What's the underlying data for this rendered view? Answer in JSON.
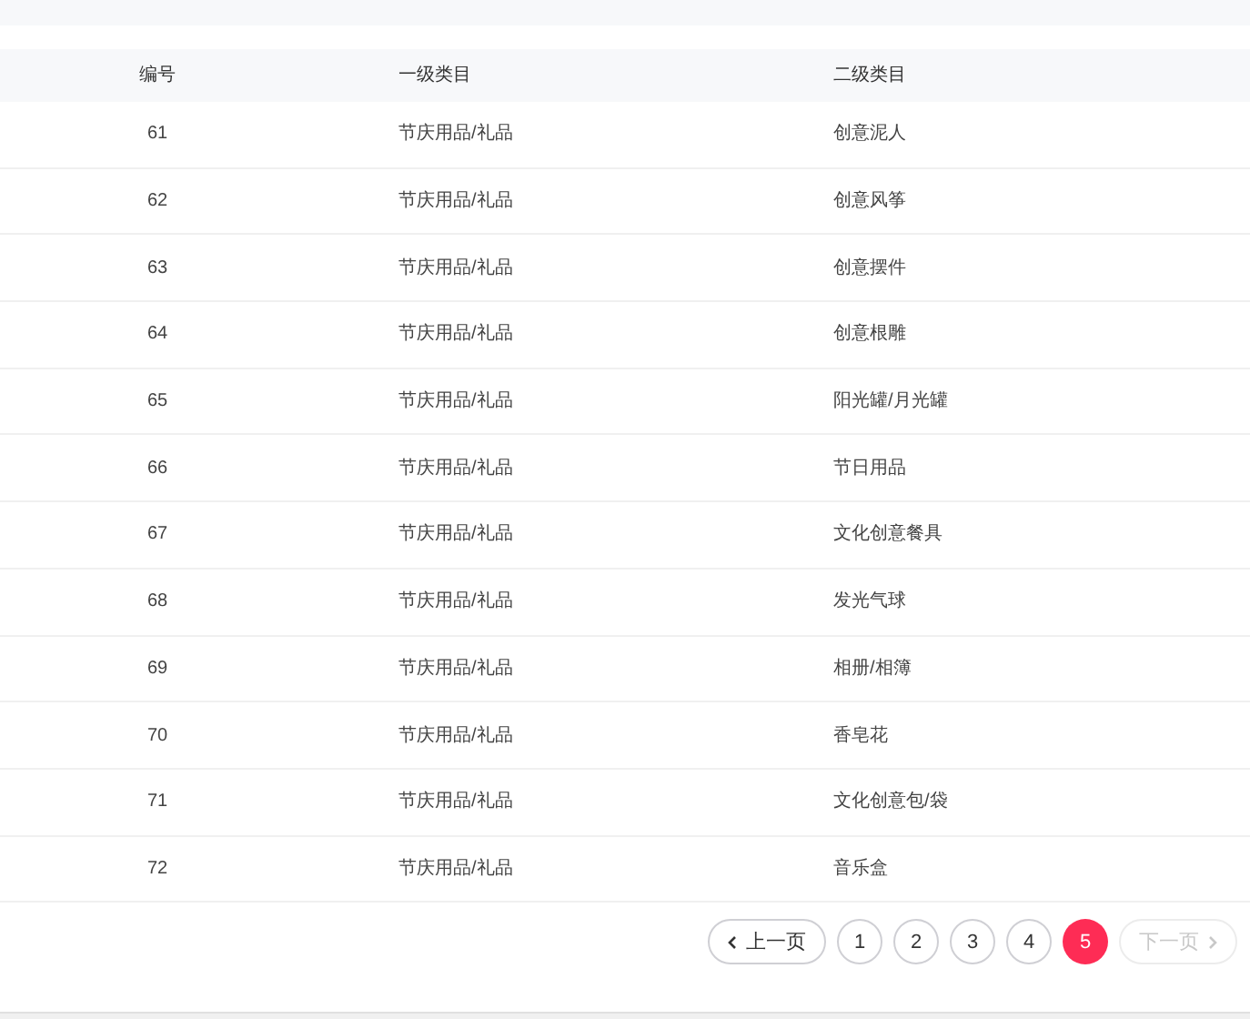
{
  "table": {
    "columns": [
      "编号",
      "一级类目",
      "二级类目"
    ],
    "rows": [
      {
        "id": "61",
        "level1": "节庆用品/礼品",
        "level2": "创意泥人"
      },
      {
        "id": "62",
        "level1": "节庆用品/礼品",
        "level2": "创意风筝"
      },
      {
        "id": "63",
        "level1": "节庆用品/礼品",
        "level2": "创意摆件"
      },
      {
        "id": "64",
        "level1": "节庆用品/礼品",
        "level2": "创意根雕"
      },
      {
        "id": "65",
        "level1": "节庆用品/礼品",
        "level2": "阳光罐/月光罐"
      },
      {
        "id": "66",
        "level1": "节庆用品/礼品",
        "level2": "节日用品"
      },
      {
        "id": "67",
        "level1": "节庆用品/礼品",
        "level2": "文化创意餐具"
      },
      {
        "id": "68",
        "level1": "节庆用品/礼品",
        "level2": "发光气球"
      },
      {
        "id": "69",
        "level1": "节庆用品/礼品",
        "level2": "相册/相簿"
      },
      {
        "id": "70",
        "level1": "节庆用品/礼品",
        "level2": "香皂花"
      },
      {
        "id": "71",
        "level1": "节庆用品/礼品",
        "level2": "文化创意包/袋"
      },
      {
        "id": "72",
        "level1": "节庆用品/礼品",
        "level2": "音乐盒"
      }
    ]
  },
  "pagination": {
    "prev": {
      "label": "上一页",
      "disabled": false
    },
    "pages": [
      {
        "label": "1",
        "selected": false
      },
      {
        "label": "2",
        "selected": false
      },
      {
        "label": "3",
        "selected": false
      },
      {
        "label": "4",
        "selected": false
      },
      {
        "label": "5",
        "selected": true
      }
    ],
    "next": {
      "label": "下一页",
      "disabled": true
    }
  }
}
